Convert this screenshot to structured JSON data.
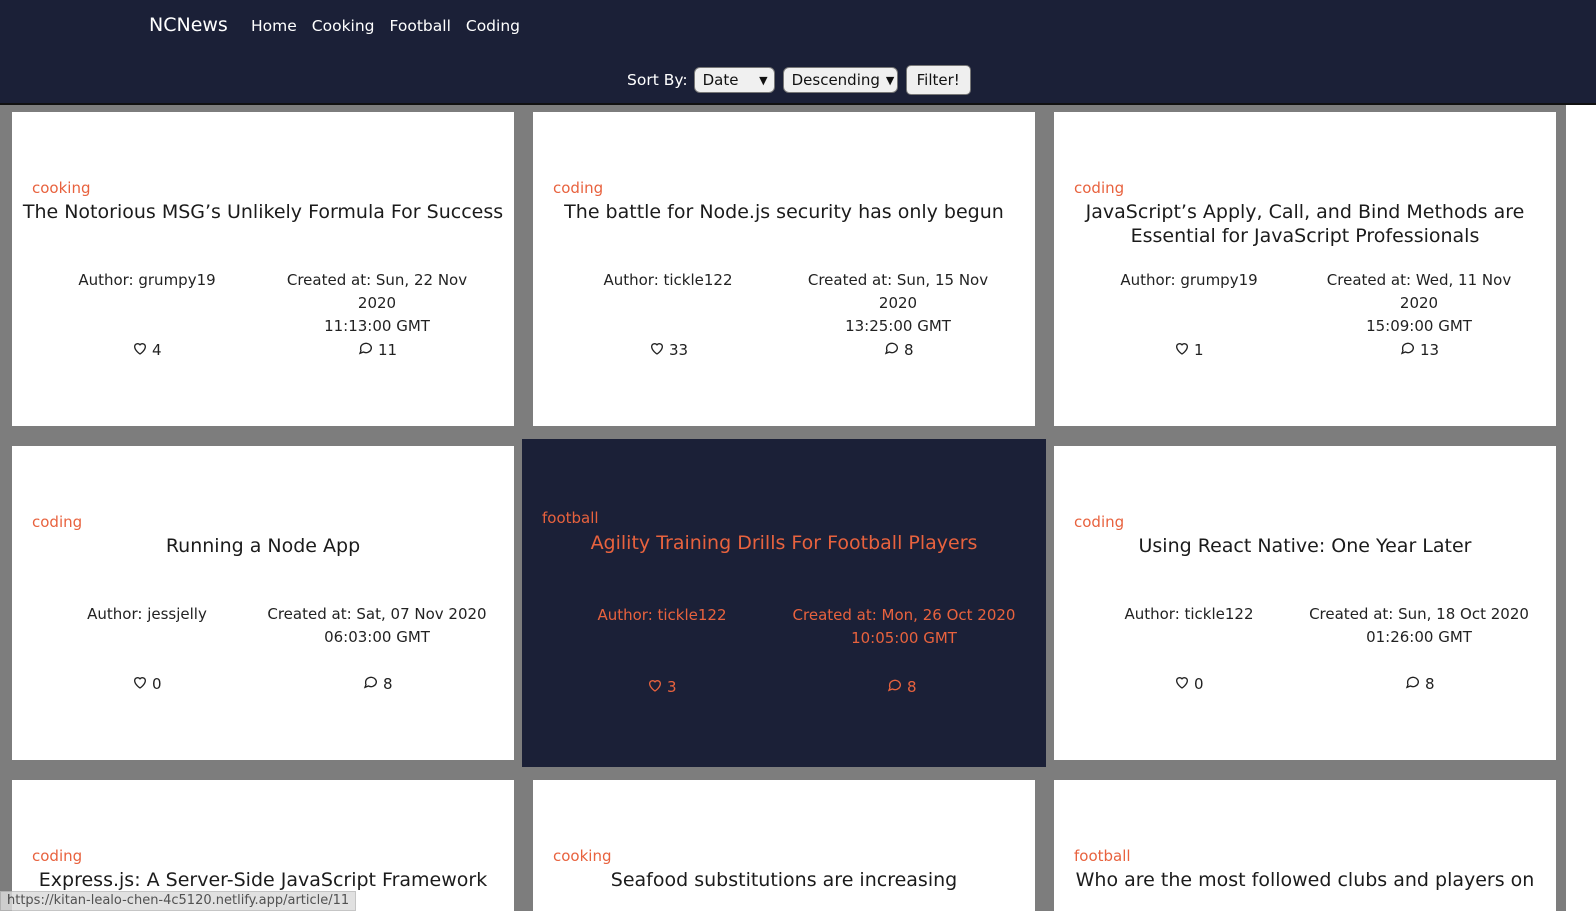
{
  "header": {
    "brand": "NCNews",
    "nav": [
      "Home",
      "Cooking",
      "Football",
      "Coding"
    ],
    "sort_label": "Sort By:",
    "sort_by_value": "Date",
    "order_value": "Descending",
    "filter_button": "Filter!"
  },
  "articles": [
    {
      "topic": "cooking",
      "title": "The Notorious MSG’s Unlikely Formula For Success",
      "author": "Author: grumpy19",
      "created_line1": "Created at: Sun, 22 Nov 2020",
      "created_line2": "11:13:00 GMT",
      "likes": "4",
      "comments": "11"
    },
    {
      "topic": "coding",
      "title": "The battle for Node.js security has only begun",
      "author": "Author: tickle122",
      "created_line1": "Created at: Sun, 15 Nov 2020",
      "created_line2": "13:25:00 GMT",
      "likes": "33",
      "comments": "8"
    },
    {
      "topic": "coding",
      "title": "JavaScript’s Apply, Call, and Bind Methods are Essential for JavaScript Professionals",
      "author": "Author: grumpy19",
      "created_line1": "Created at: Wed, 11 Nov 2020",
      "created_line2": "15:09:00 GMT",
      "likes": "1",
      "comments": "13"
    },
    {
      "topic": "coding",
      "title": "Running a Node App",
      "author": "Author: jessjelly",
      "created_line1": "Created at: Sat, 07 Nov 2020",
      "created_line2": "06:03:00 GMT",
      "likes": "0",
      "comments": "8"
    },
    {
      "topic": "football",
      "title": "Agility Training Drills For Football Players",
      "author": "Author: tickle122",
      "created_line1": "Created at: Mon, 26 Oct 2020",
      "created_line2": "10:05:00 GMT",
      "likes": "3",
      "comments": "8"
    },
    {
      "topic": "coding",
      "title": "Using React Native: One Year Later",
      "author": "Author: tickle122",
      "created_line1": "Created at: Sun, 18 Oct 2020",
      "created_line2": "01:26:00 GMT",
      "likes": "0",
      "comments": "8"
    },
    {
      "topic": "coding",
      "title": "Express.js: A Server-Side JavaScript Framework"
    },
    {
      "topic": "cooking",
      "title": "Seafood substitutions are increasing"
    },
    {
      "topic": "football",
      "title": "Who are the most followed clubs and players on"
    }
  ],
  "status_url": "https://kitan-lealo-chen-4c5120.netlify.app/article/11",
  "colors": {
    "header_bg": "#1b2037",
    "accent": "#e8623e",
    "page_bg": "#7d7d7d"
  }
}
